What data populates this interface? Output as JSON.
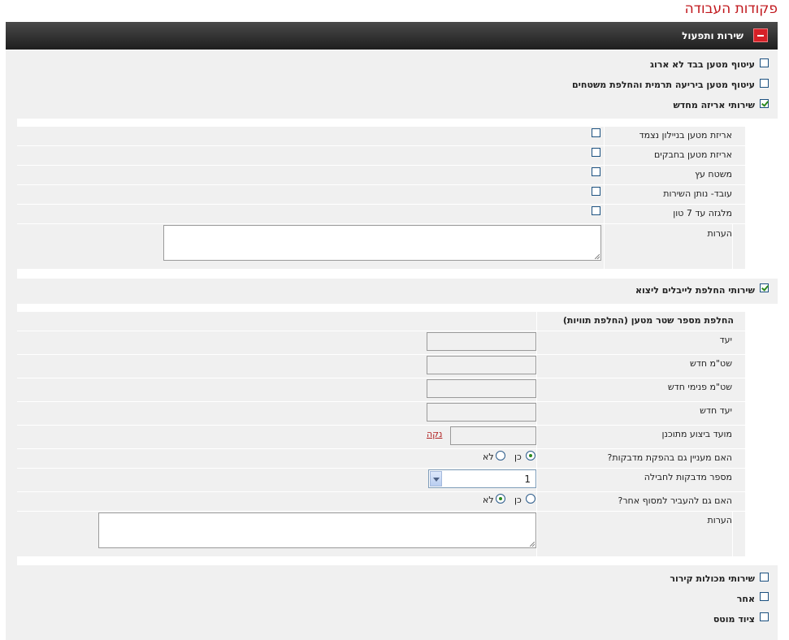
{
  "page": {
    "title": "פקודות העבודה"
  },
  "section": {
    "title": "שירות ותפעול"
  },
  "services": [
    {
      "label": "עיטוף מטען בבד לא ארוג",
      "checked": false
    },
    {
      "label": "עיטוף מטען ביריעה תרמית והחלפת משטחים",
      "checked": false
    },
    {
      "label": "שירותי אריזה מחדש",
      "checked": true
    }
  ],
  "repack": {
    "options": [
      {
        "label": "אריזת מטען בניילון נצמד",
        "checked": false
      },
      {
        "label": "אריזת מטען בחבקים",
        "checked": false
      },
      {
        "label": "משטח עץ",
        "checked": false
      },
      {
        "label": "עובד- נותן השירות",
        "checked": false
      },
      {
        "label": "מלגזה עד 7 טון",
        "checked": false
      }
    ],
    "notes_label": "הערות"
  },
  "labels_service": {
    "label": "שירותי החלפת לייבלים ליצוא",
    "checked": true
  },
  "labels": {
    "header": "החלפת מספר שטר מטען (החלפת תוויות)",
    "fields": [
      {
        "label": "יעד",
        "value": ""
      },
      {
        "label": "שט\"מ חדש",
        "value": ""
      },
      {
        "label": "שט\"מ פנימי חדש",
        "value": ""
      },
      {
        "label": "יעד חדש",
        "value": ""
      }
    ],
    "planned_label": "מועד ביצוע מתוכנן",
    "planned_value": "",
    "clear_link": "נקה",
    "stickers_q": "האם מעניין גם בהפקת מדבקות?",
    "stickers_yes": "כן",
    "stickers_no": "לא",
    "stickers_answer": "yes",
    "per_package_label": "מספר מדבקות לחבילה",
    "per_package_value": "1",
    "transfer_q": "האם גם להעביר למסוף אחר?",
    "transfer_yes": "כן",
    "transfer_no": "לא",
    "transfer_answer": "no",
    "notes_label": "הערות"
  },
  "more_services": [
    {
      "label": "שירותי מכולות קירור",
      "checked": false
    },
    {
      "label": "אחר",
      "checked": false
    },
    {
      "label": "ציוד מוטס",
      "checked": false
    }
  ]
}
